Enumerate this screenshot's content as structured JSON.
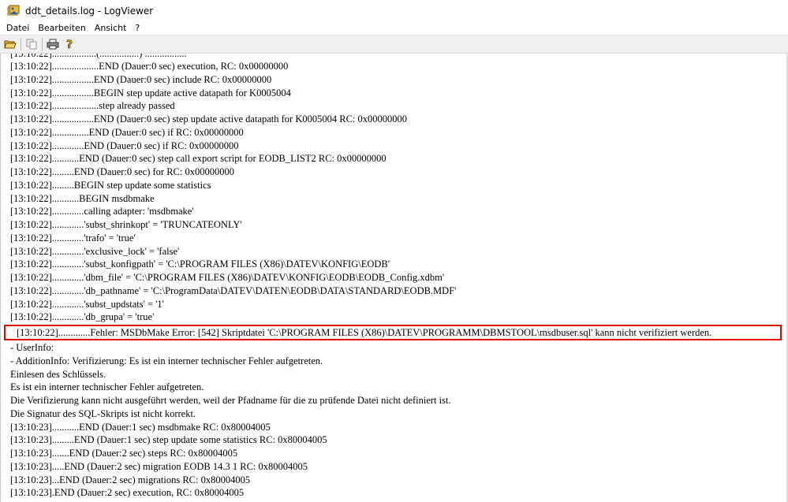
{
  "window": {
    "title": "ddt_details.log - LogViewer"
  },
  "menu": {
    "items": [
      "Datei",
      "Bearbeiten",
      "Ansicht",
      "?"
    ]
  },
  "toolbar": {
    "buttons": [
      "open-folder-icon",
      "copy-icon",
      "print-icon",
      "help-icon"
    ]
  },
  "log": {
    "partial_top": "[13:10:22]..................(................) .................",
    "lines": [
      "[13:10:22]...................END (Dauer:0 sec) execution, RC: 0x00000000",
      "[13:10:22].................END (Dauer:0 sec) include RC: 0x00000000",
      "[13:10:22].................BEGIN step update active datapath for K0005004",
      "[13:10:22]...................step already passed",
      "[13:10:22].................END (Dauer:0 sec) step update active datapath for K0005004 RC: 0x00000000",
      "[13:10:22]...............END (Dauer:0 sec) if RC: 0x00000000",
      "[13:10:22].............END (Dauer:0 sec) if RC: 0x00000000",
      "[13:10:22]...........END (Dauer:0 sec) step call export script for EODB_LIST2 RC: 0x00000000",
      "[13:10:22].........END (Dauer:0 sec) for RC: 0x00000000",
      "[13:10:22].........BEGIN step update some statistics",
      "[13:10:22]...........BEGIN msdbmake",
      "[13:10:22].............calling adapter: 'msdbmake'",
      "[13:10:22].............'subst_shrinkopt' = 'TRUNCATEONLY'",
      "[13:10:22].............'trafo' = 'true'",
      "[13:10:22].............'exclusive_lock' = 'false'",
      "[13:10:22].............'subst_konfigpath' = 'C:\\PROGRAM FILES (X86)\\DATEV\\KONFIG\\EODB'",
      "[13:10:22].............'dbm_file' = 'C:\\PROGRAM FILES (X86)\\DATEV\\KONFIG\\EODB\\EODB_Config.xdbm'",
      "[13:10:22].............'db_pathname' = 'C:\\ProgramData\\DATEV\\DATEN\\EODB\\DATA\\STANDARD\\EODB.MDF'",
      "[13:10:22].............'subst_updstats' = '1'",
      "[13:10:22].............'db_grupa' = 'true'"
    ],
    "highlighted_line": "[13:10:22].............Fehler: MSDbMake Error: [542] Skriptdatei 'C:\\PROGRAM FILES (X86)\\DATEV\\PROGRAMM\\DBMSTOOL\\msdbuser.sql' kann nicht verifiziert werden.",
    "after_lines": [
      "- UserInfo:",
      "- AdditionInfo: Verifizierung: Es ist ein interner technischer Fehler aufgetreten.",
      "Einlesen des Schlüssels.",
      "Es ist ein interner technischer Fehler aufgetreten.",
      "Die Verifizierung kann nicht ausgeführt werden, weil der Pfadname für die zu prüfende Datei nicht definiert ist.",
      "Die Signatur des SQL-Skripts ist nicht korrekt.",
      "[13:10:23]...........END (Dauer:1 sec) msdbmake RC: 0x80004005",
      "[13:10:23].........END (Dauer:1 sec) step update some statistics RC: 0x80004005",
      "[13:10:23].......END (Dauer:2 sec) steps RC: 0x80004005",
      "[13:10:23].....END (Dauer:2 sec) migration EODB 14.3 1 RC: 0x80004005",
      "[13:10:23]...END (Dauer:2 sec) migrations RC: 0x80004005",
      "[13:10:23].END (Dauer:2 sec) execution, RC: 0x80004005"
    ]
  },
  "colors": {
    "highlight_border": "#e00000"
  }
}
